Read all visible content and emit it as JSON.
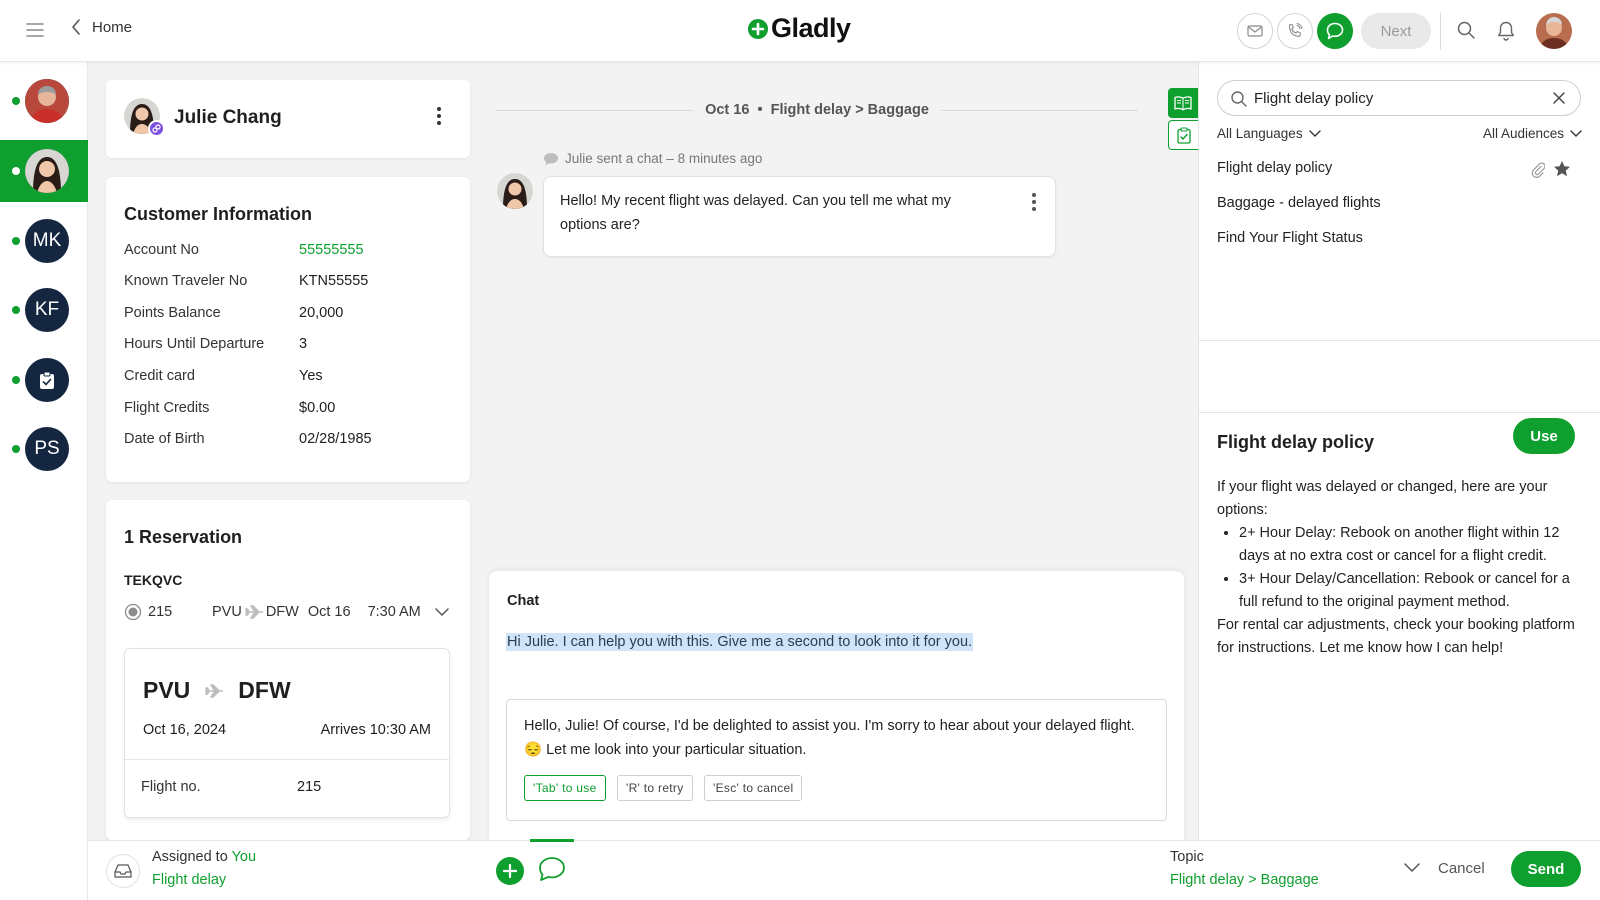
{
  "topbar": {
    "home_label": "Home",
    "logo_text": "Gladly",
    "next_label": "Next",
    "icons": [
      "menu-icon",
      "chevron-left-icon",
      "email-icon",
      "phone-icon",
      "chat-icon",
      "search-icon",
      "bell-icon"
    ]
  },
  "rail": {
    "items": [
      {
        "initials": "",
        "active": false
      },
      {
        "initials": "",
        "active": true
      },
      {
        "initials": "MK",
        "active": false
      },
      {
        "initials": "KF",
        "active": false
      },
      {
        "initials": "",
        "active": false,
        "icon": "clipboard-icon"
      },
      {
        "initials": "PS",
        "active": false
      }
    ]
  },
  "customer": {
    "name": "Julie Chang"
  },
  "info": {
    "title": "Customer Information",
    "rows": [
      {
        "label": "Account No",
        "value": "55555555"
      },
      {
        "label": "Known Traveler No",
        "value": "KTN55555"
      },
      {
        "label": "Points Balance",
        "value": "20,000"
      },
      {
        "label": "Hours Until Departure",
        "value": "3"
      },
      {
        "label": "Credit card",
        "value": "Yes"
      },
      {
        "label": "Flight Credits",
        "value": "$0.00"
      },
      {
        "label": "Date of Birth",
        "value": "02/28/1985"
      }
    ]
  },
  "reservation": {
    "title": "1 Reservation",
    "code": "TEKQVC",
    "flight_no": "215",
    "origin": "PVU",
    "destination": "DFW",
    "date_short": "Oct 16",
    "time": "7:30 AM",
    "date_long": "Oct 16, 2024",
    "arrives": "Arrives 10:30 AM",
    "flight_no_label": "Flight no."
  },
  "conversation": {
    "header": "Oct 16  •  Flight delay > Baggage",
    "meta": "Julie sent a chat – 8 minutes ago",
    "message": "Hello! My recent flight was delayed. Can you tell me what my options are?"
  },
  "composer": {
    "title": "Chat",
    "draft": "Hi Julie. I can help you with this. Give me a second to look into it for you.",
    "suggestion_pre": "Hello, Julie! Of course, I'd be delighted to assist you. I'm sorry to hear about your delayed flight.",
    "suggestion_emoji": "😔",
    "suggestion_post": "Let me look into your particular situation.",
    "chips": {
      "tab": "'Tab' to use",
      "retry": "'R' to retry",
      "esc": "'Esc' to cancel"
    }
  },
  "bottombar": {
    "assigned_prefix": "Assigned to",
    "assigned_to": "You",
    "inbox": "Flight delay",
    "topic_label": "Topic",
    "topic_value": "Flight delay > Baggage",
    "cancel_label": "Cancel",
    "send_label": "Send"
  },
  "kb": {
    "search_value": "Flight delay policy",
    "languages": "All Languages",
    "audiences": "All Audiences",
    "results": [
      "Flight delay policy",
      "Baggage - delayed flights",
      "Find Your Flight Status"
    ],
    "article_title": "Flight delay policy",
    "use_label": "Use",
    "article_intro": "If your flight was delayed or changed, here are your options:",
    "article_bullets": [
      "2+ Hour Delay: Rebook on another flight within 12 days at no extra cost or cancel for a flight credit.",
      "3+ Hour Delay/Cancellation: Rebook or cancel for a full refund to the original payment method."
    ],
    "article_outro": "For rental car adjustments, check your booking platform for instructions. Let me know how I can help!"
  },
  "colors": {
    "accent": "#0e9f2e",
    "navy_avatar": "#142640",
    "badge_purple": "#7b4fe0",
    "highlight": "#cfe4f7"
  }
}
